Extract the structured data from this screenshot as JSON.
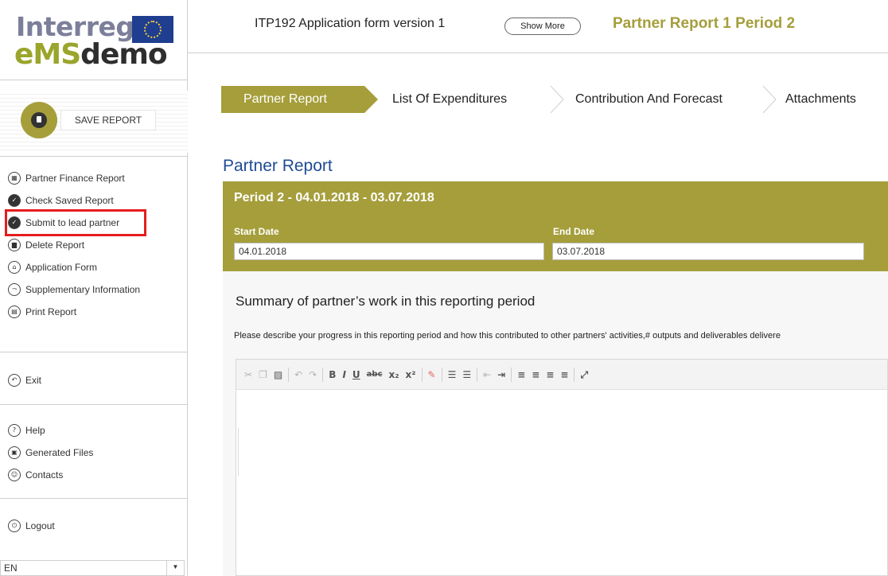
{
  "logo": {
    "top_text": "Interreg",
    "brand_part1": "eMS",
    "brand_part2": "demo"
  },
  "sidebar": {
    "save_label": "SAVE REPORT",
    "menu": [
      {
        "label": "Partner Finance Report",
        "icon": "grid-icon"
      },
      {
        "label": "Check Saved Report",
        "icon": "check-circle-icon"
      },
      {
        "label": "Submit to lead partner",
        "icon": "check-circle-icon"
      },
      {
        "label": "Delete Report",
        "icon": "trash-icon"
      },
      {
        "label": "Application Form",
        "icon": "building-icon"
      },
      {
        "label": "Supplementary Information",
        "icon": "hook-icon"
      },
      {
        "label": "Print Report",
        "icon": "print-icon"
      }
    ],
    "exit_label": "Exit",
    "help_label": "Help",
    "generated_files_label": "Generated Files",
    "contacts_label": "Contacts",
    "logout_label": "Logout",
    "language": "EN"
  },
  "header": {
    "form_version": "ITP192 Application form version 1",
    "show_more_label": "Show More",
    "report_title": "Partner Report 1 Period 2"
  },
  "tabs": [
    "Partner Report",
    "List Of Expenditures",
    "Contribution And Forecast",
    "Attachments"
  ],
  "main": {
    "page_title": "Partner Report",
    "period_title": "Period 2 - 04.01.2018 - 03.07.2018",
    "start_date_label": "Start Date",
    "start_date_value": "04.01.2018",
    "end_date_label": "End Date",
    "end_date_value": "03.07.2018",
    "summary_title": "Summary of partner’s work in this reporting period",
    "summary_description": "Please describe your progress in this reporting period and how this contributed to other partners' activities,# outputs and deliverables delivere"
  },
  "colors": {
    "accent_olive": "#a59e3b",
    "title_blue": "#1f4c94",
    "highlight_red": "#e51d1d"
  }
}
